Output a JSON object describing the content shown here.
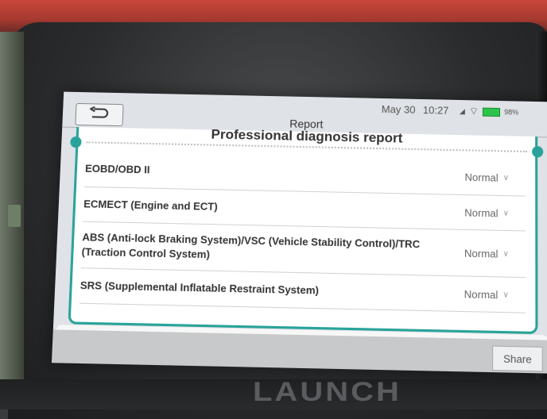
{
  "status": {
    "date": "May 30",
    "time": "10:27",
    "battery": "98%"
  },
  "header": {
    "title": "Report",
    "back_icon": "back-arrow-icon"
  },
  "report": {
    "heading": "Professional diagnosis report",
    "rows": [
      {
        "label": "EOBD/OBD II",
        "status": "Normal"
      },
      {
        "label": "ECMECT (Engine and ECT)",
        "status": "Normal"
      },
      {
        "label": "ABS (Anti-lock Braking System)/VSC (Vehicle Stability Control)/TRC (Traction Control System)",
        "status": "Normal"
      },
      {
        "label": "SRS (Supplemental Inflatable Restraint System)",
        "status": "Normal"
      }
    ]
  },
  "footer": {
    "share_label": "Share"
  },
  "device": {
    "brand": "LAUNCH"
  },
  "colors": {
    "accent": "#29a39a",
    "battery": "#2cc44b"
  }
}
